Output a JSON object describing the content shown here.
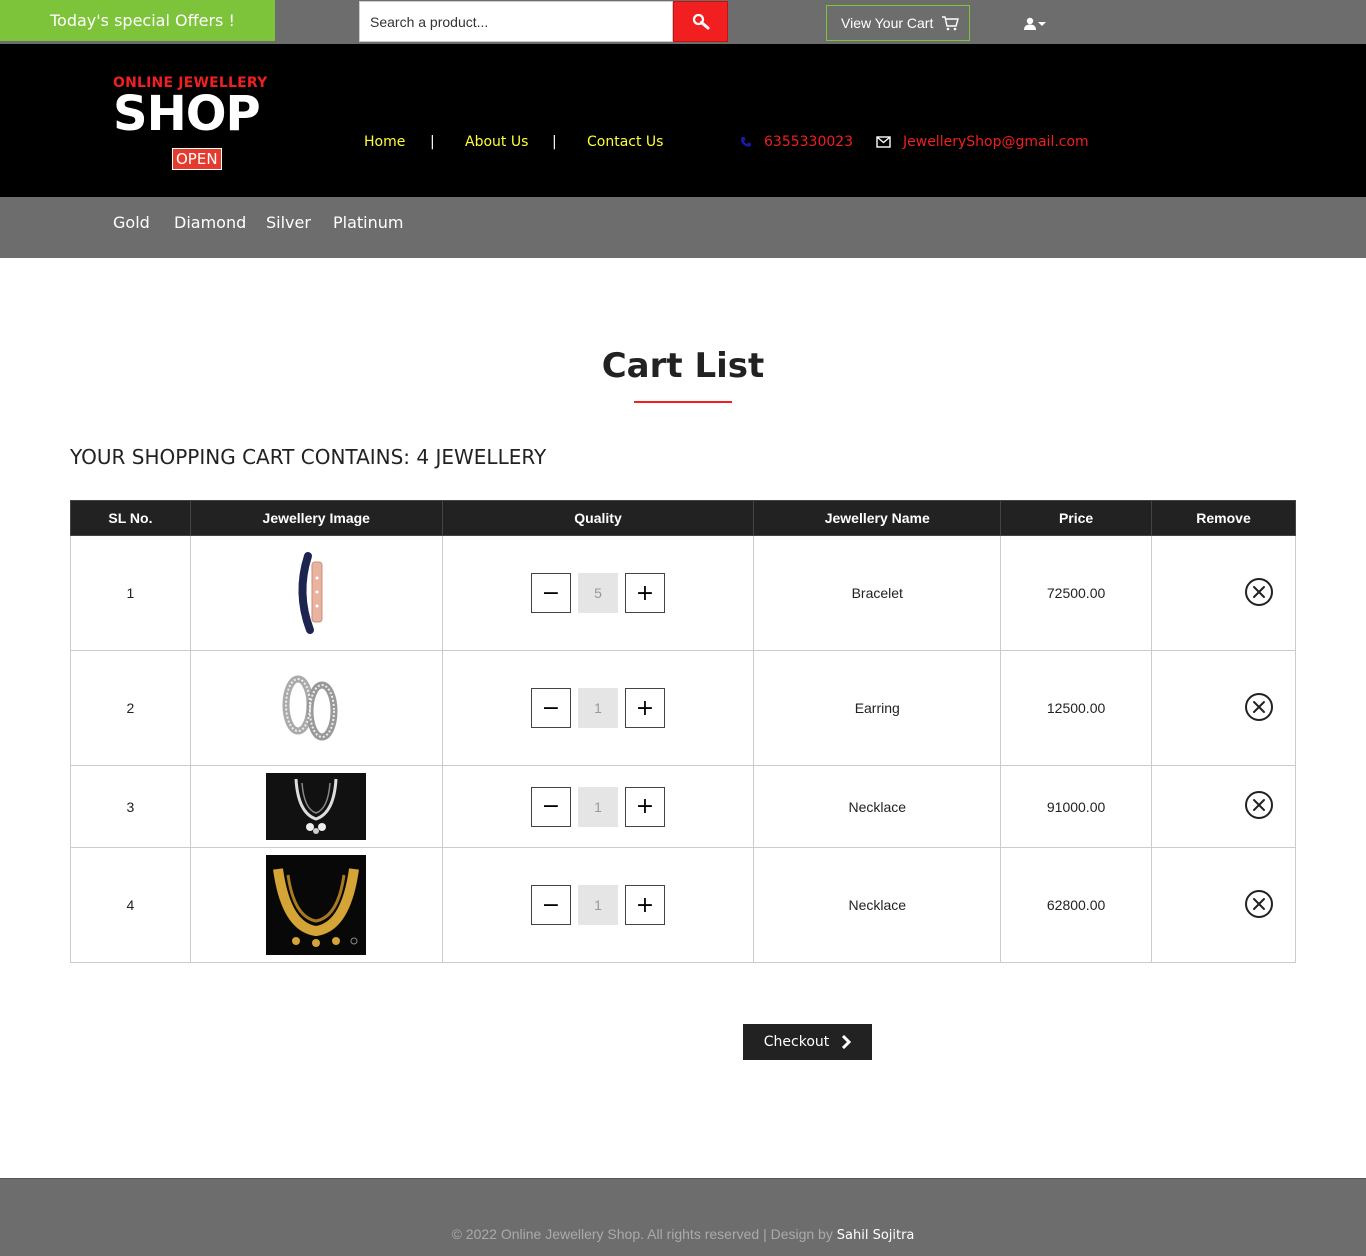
{
  "topbar": {
    "offers": "Today's special Offers !",
    "search_placeholder": "Search a product...",
    "cart_button": "View Your Cart"
  },
  "header": {
    "logo_top": "ONLINE JEWELLERY",
    "logo_main": "SHOP",
    "logo_open": "OPEN",
    "nav": [
      "Home",
      "About Us",
      "Contact Us"
    ],
    "separator": "|",
    "phone": "6355330023",
    "email": "JewelleryShop@gmail.com"
  },
  "categories": [
    "Gold",
    "Diamond",
    "Silver",
    "Platinum"
  ],
  "main": {
    "title": "Cart List",
    "cart_count": "YOUR SHOPPING CART CONTAINS: 4 JEWELLERY",
    "columns": [
      "SL No.",
      "Jewellery Image",
      "Quality",
      "Jewellery Name",
      "Price",
      "Remove"
    ],
    "rows": [
      {
        "sl": "1",
        "qty": "5",
        "name": "Bracelet",
        "price": "72500.00"
      },
      {
        "sl": "2",
        "qty": "1",
        "name": "Earring",
        "price": "12500.00"
      },
      {
        "sl": "3",
        "qty": "1",
        "name": "Necklace",
        "price": "91000.00"
      },
      {
        "sl": "4",
        "qty": "1",
        "name": "Necklace",
        "price": "62800.00"
      }
    ],
    "checkout": "Checkout"
  },
  "footer": {
    "text": "© 2022 Online Jewellery Shop. All rights reserved | Design by",
    "author": "Sahil Sojitra"
  },
  "colors": {
    "accent": "#f11f1f",
    "offer_green": "#7dc43b",
    "nav_yellow": "#ffff33",
    "bar_gray": "#6d6d6d"
  }
}
